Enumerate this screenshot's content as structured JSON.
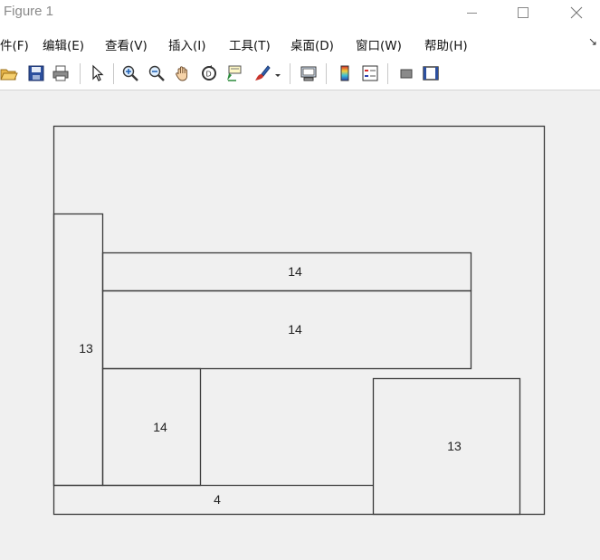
{
  "window": {
    "title": "Figure 1",
    "controls": [
      "minimize",
      "maximize",
      "close"
    ]
  },
  "menubar": {
    "items": [
      {
        "label": "件(F)"
      },
      {
        "label": "编辑(E)"
      },
      {
        "label": "查看(V)"
      },
      {
        "label": "插入(I)"
      },
      {
        "label": "工具(T)"
      },
      {
        "label": "桌面(D)"
      },
      {
        "label": "窗口(W)"
      },
      {
        "label": "帮助(H)"
      }
    ],
    "overflow_icon": "chevron-expand-icon"
  },
  "toolbar": {
    "tools": [
      "open-file-icon",
      "save-icon",
      "print-icon",
      "select-pointer-icon",
      "zoom-in-icon",
      "zoom-out-icon",
      "pan-hand-icon",
      "rotate-3d-icon",
      "data-cursor-icon",
      "brush-icon",
      "brush-dropdown-icon",
      "link-plot-icon",
      "colorbar-icon",
      "legend-icon",
      "hide-plot-tools-icon",
      "show-plot-tools-icon"
    ]
  },
  "figure": {
    "regions": [
      {
        "label": "14"
      },
      {
        "label": "14"
      },
      {
        "label": "13"
      },
      {
        "label": "14"
      },
      {
        "label": "13"
      },
      {
        "label": "4"
      }
    ]
  }
}
